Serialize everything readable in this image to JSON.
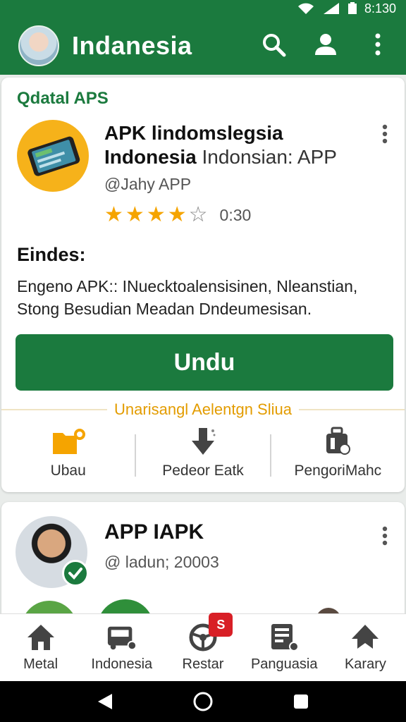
{
  "status_bar": {
    "time": "8:130"
  },
  "app_bar": {
    "title": "Indanesia"
  },
  "card1": {
    "section_title": "Qdatal APS",
    "app_name_bold": "APK lindomslegsia Indonesia",
    "app_name_rest": "Indonsian: APP",
    "developer": "@Jahy APP",
    "rating": {
      "stars_filled": 4,
      "stars_total": 5,
      "value_text": "0:30"
    },
    "description_heading": "Eindes:",
    "description": "Engeno APK:: INuecktoalensisinen, Nleanstian, Stong Besudian Meadan Dndeumesisan.",
    "install_button": "Undu",
    "divider_label": "Unarisangl Aelentgn Sliua",
    "quick_actions": [
      {
        "label": "Ubau",
        "icon": "folder-icon"
      },
      {
        "label": "Pedeor Eatk",
        "icon": "download-arrow-icon"
      },
      {
        "label": "PengoriMahc",
        "icon": "luggage-icon"
      }
    ]
  },
  "card2": {
    "title": "APP IAPK",
    "subtitle": "@ ladun; 20003"
  },
  "bottom_nav": [
    {
      "label": "Metal",
      "icon": "home-icon"
    },
    {
      "label": "Indonesia",
      "icon": "bus-icon"
    },
    {
      "label": "Restar",
      "icon": "steering-wheel-icon",
      "badge": "S"
    },
    {
      "label": "Panguasia",
      "icon": "document-icon"
    },
    {
      "label": "Karary",
      "icon": "house-roof-icon"
    }
  ],
  "colors": {
    "primary": "#1b7a3e",
    "accent": "#f5a400",
    "badge": "#d81f26"
  }
}
